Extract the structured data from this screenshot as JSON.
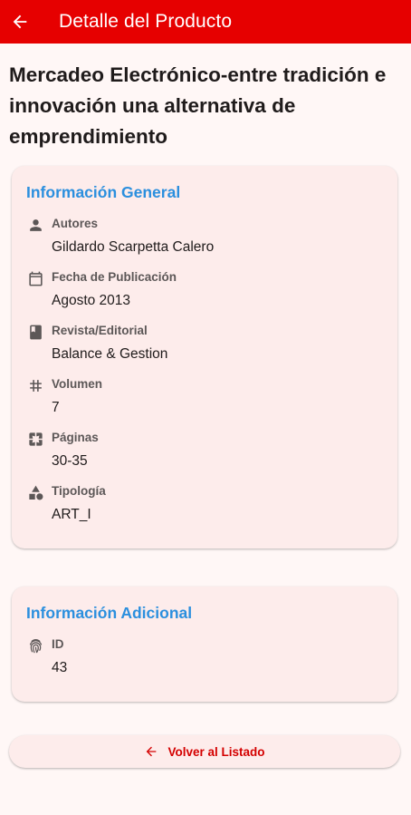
{
  "app_bar": {
    "title": "Detalle del Producto",
    "back_icon": "arrow-back-icon",
    "background": "#e60000"
  },
  "product": {
    "title": "Mercadeo Electrónico-entre tradición e innovación una alternativa de emprendimiento"
  },
  "general_info": {
    "title": "Información General",
    "fields": [
      {
        "icon": "person-icon",
        "label": "Autores",
        "value": "Gildardo Scarpetta Calero"
      },
      {
        "icon": "calendar-icon",
        "label": "Fecha de Publicación",
        "value": "Agosto 2013"
      },
      {
        "icon": "book-icon",
        "label": "Revista/Editorial",
        "value": "Balance & Gestion"
      },
      {
        "icon": "hash-icon",
        "label": "Volumen",
        "value": "7"
      },
      {
        "icon": "pages-icon",
        "label": "Páginas",
        "value": "30-35"
      },
      {
        "icon": "category-icon",
        "label": "Tipología",
        "value": "ART_I"
      }
    ]
  },
  "additional_info": {
    "title": "Información Adicional",
    "fields": [
      {
        "icon": "fingerprint-icon",
        "label": "ID",
        "value": "43"
      }
    ]
  },
  "back_button": {
    "label": "Volver al Listado",
    "icon": "arrow-back-icon"
  },
  "colors": {
    "accent": "#e60000",
    "section_title": "#2b8fde",
    "card_background": "#fdeceb",
    "page_background": "#fff7f6"
  }
}
